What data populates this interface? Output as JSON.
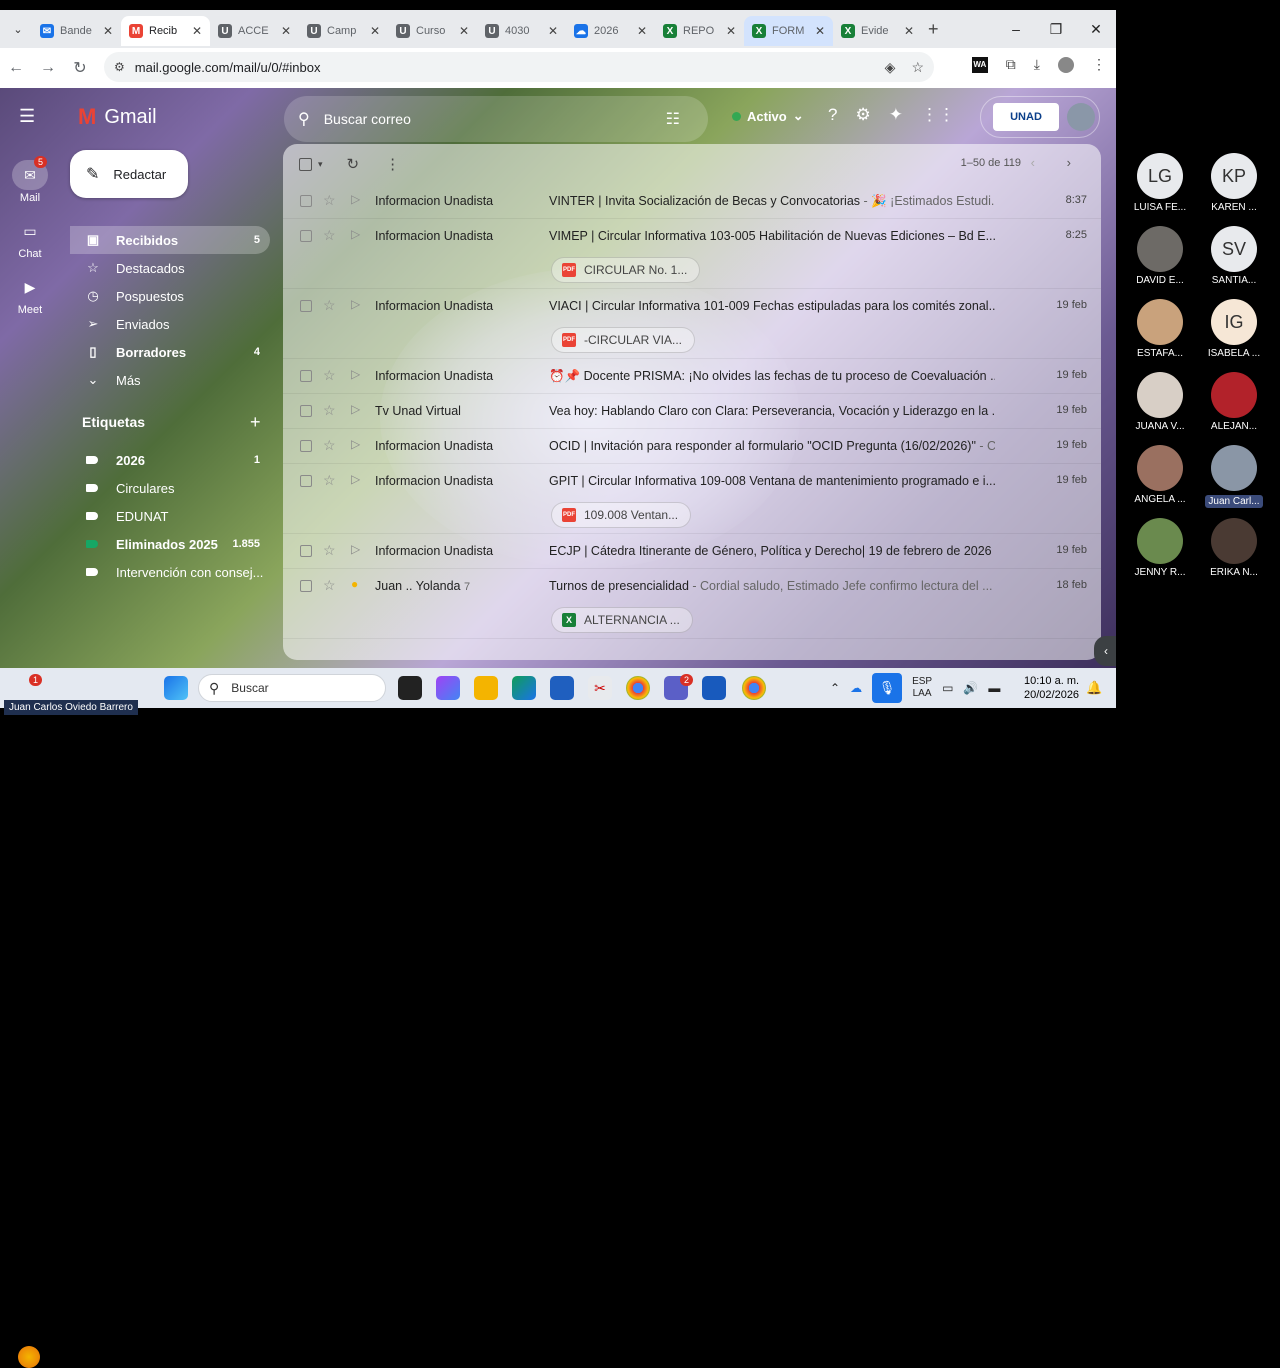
{
  "browser": {
    "tabs": [
      {
        "label": "Bande",
        "color": "#1a73e8",
        "glyph": "✉"
      },
      {
        "label": "Recib",
        "color": "#ea4335",
        "glyph": "M",
        "active": true
      },
      {
        "label": "ACCE",
        "color": "#5f6368",
        "glyph": "U"
      },
      {
        "label": "Camp",
        "color": "#5f6368",
        "glyph": "U"
      },
      {
        "label": "Curso",
        "color": "#5f6368",
        "glyph": "U"
      },
      {
        "label": "4030",
        "color": "#5f6368",
        "glyph": "U"
      },
      {
        "label": "2026",
        "color": "#1a73e8",
        "glyph": "☁"
      },
      {
        "label": "REPO",
        "color": "#188038",
        "glyph": "X"
      },
      {
        "label": "FORM",
        "color": "#188038",
        "glyph": "X",
        "highlight": true
      },
      {
        "label": "Evide",
        "color": "#188038",
        "glyph": "X"
      }
    ],
    "url": "mail.google.com/mail/u/0/#inbox"
  },
  "gmail": {
    "logo_text": "Gmail",
    "search_placeholder": "Buscar correo",
    "status_label": "Activo",
    "account_logo": "UNAD",
    "rail": {
      "mail_label": "Mail",
      "mail_badge": "5",
      "chat_label": "Chat",
      "meet_label": "Meet"
    },
    "compose_label": "Redactar",
    "sidebar": [
      {
        "label": "Recibidos",
        "count": "5",
        "icon": "inbox-icon",
        "glyph": "▣"
      },
      {
        "label": "Destacados",
        "count": "",
        "icon": "star-icon",
        "glyph": "☆"
      },
      {
        "label": "Pospuestos",
        "count": "",
        "icon": "clock-icon",
        "glyph": "◷"
      },
      {
        "label": "Enviados",
        "count": "",
        "icon": "send-icon",
        "glyph": "➢"
      },
      {
        "label": "Borradores",
        "count": "4",
        "icon": "draft-icon",
        "glyph": "▯"
      },
      {
        "label": "Más",
        "count": "",
        "icon": "chevron-down-icon",
        "glyph": "⌄"
      }
    ],
    "labels_title": "Etiquetas",
    "labels": [
      {
        "label": "2026",
        "count": "1",
        "color": "#ffffff"
      },
      {
        "label": "Circulares",
        "count": "",
        "color": "#ffffff"
      },
      {
        "label": "EDUNAT",
        "count": "",
        "color": "#ffffff"
      },
      {
        "label": "Eliminados 2025",
        "count": "1.855",
        "color": "#16a765"
      },
      {
        "label": "Intervención con consej...",
        "count": "",
        "color": "#ffffff"
      }
    ],
    "pagination": "1–50 de 119",
    "emails": [
      {
        "from": "Informacion Unadista",
        "subject": "VINTER | Invita Socialización de Becas y Convocatorias",
        "snippet": " - 🎉 ¡Estimados Estudi...",
        "date": "8:37",
        "attachment": "",
        "att_type": ""
      },
      {
        "from": "Informacion Unadista",
        "subject": "VIMEP | Circular Informativa 103-005 Habilitación de Nuevas Ediciones – Bd E...",
        "snippet": "",
        "date": "8:25",
        "attachment": "CIRCULAR No. 1...",
        "att_type": "pdf"
      },
      {
        "from": "Informacion Unadista",
        "subject": "VIACI | Circular Informativa 101-009 Fechas estipuladas para los comités zonal...",
        "snippet": "",
        "date": "19 feb",
        "attachment": "-CIRCULAR VIA...",
        "att_type": "pdf"
      },
      {
        "from": "Informacion Unadista",
        "subject": "⏰📌 Docente PRISMA: ¡No olvides las fechas de tu proceso de Coevaluación ...",
        "snippet": "",
        "date": "19 feb",
        "attachment": "",
        "att_type": ""
      },
      {
        "from": "Tv Unad Virtual",
        "subject": "Vea hoy: Hablando Claro con Clara: Perseverancia, Vocación y Liderazgo en la ...",
        "snippet": "",
        "date": "19 feb",
        "attachment": "",
        "att_type": ""
      },
      {
        "from": "Informacion Unadista",
        "subject": "OCID | Invitación para responder al formulario \"OCID Pregunta (16/02/2026)\"",
        "snippet": " - C",
        "date": "19 feb",
        "attachment": "",
        "att_type": ""
      },
      {
        "from": "Informacion Unadista",
        "subject": "GPIT | Circular Informativa 109-008 Ventana de mantenimiento programado e i...",
        "snippet": "",
        "date": "19 feb",
        "attachment": "109.008 Ventan...",
        "att_type": "pdf"
      },
      {
        "from": "Informacion Unadista",
        "subject": "ECJP | Cátedra Itinerante de Género, Política y Derecho| 19 de febrero de 2026",
        "snippet": " -",
        "date": "19 feb",
        "attachment": "",
        "att_type": ""
      },
      {
        "from": "Juan .. Yolanda",
        "from_count": "7",
        "subject": "Turnos de presencialidad",
        "snippet": " - Cordial saludo, Estimado Jefe confirmo lectura del ...",
        "date": "18 feb",
        "attachment": "ALTERNANCIA ...",
        "att_type": "xls",
        "important_yellow": true
      }
    ]
  },
  "taskbar": {
    "search_placeholder": "Buscar",
    "lang_top": "ESP",
    "lang_bottom": "LAA",
    "time": "10:10 a. m.",
    "date": "20/02/2026",
    "notif_badge": "1",
    "teams_badge": "2"
  },
  "participants": [
    {
      "initials": "LG",
      "name": "LUISA FE...",
      "bg": "#e8eaed"
    },
    {
      "initials": "KP",
      "name": "KAREN ...",
      "bg": "#e8eaed"
    },
    {
      "initials": "",
      "name": "DAVID E...",
      "bg": "#6d6a66"
    },
    {
      "initials": "SV",
      "name": "SANTIA...",
      "bg": "#e8eaed"
    },
    {
      "initials": "",
      "name": "ESTAFA...",
      "bg": "#c9a27c"
    },
    {
      "initials": "IG",
      "name": "ISABELA ...",
      "bg": "#f6e7d6"
    },
    {
      "initials": "",
      "name": "JUANA V...",
      "bg": "#d8cfc6"
    },
    {
      "initials": "",
      "name": "ALEJAN...",
      "bg": "#b2222a"
    },
    {
      "initials": "",
      "name": "ANGELA ...",
      "bg": "#9a7060"
    },
    {
      "initials": "",
      "name": "Juan Carl...",
      "bg": "#8a96a6",
      "highlight": true
    },
    {
      "initials": "",
      "name": "JENNY R...",
      "bg": "#6a8a4e"
    },
    {
      "initials": "",
      "name": "ERIKA N...",
      "bg": "#4a3a33"
    }
  ],
  "caption": "Juan Carlos Oviedo Barrero"
}
